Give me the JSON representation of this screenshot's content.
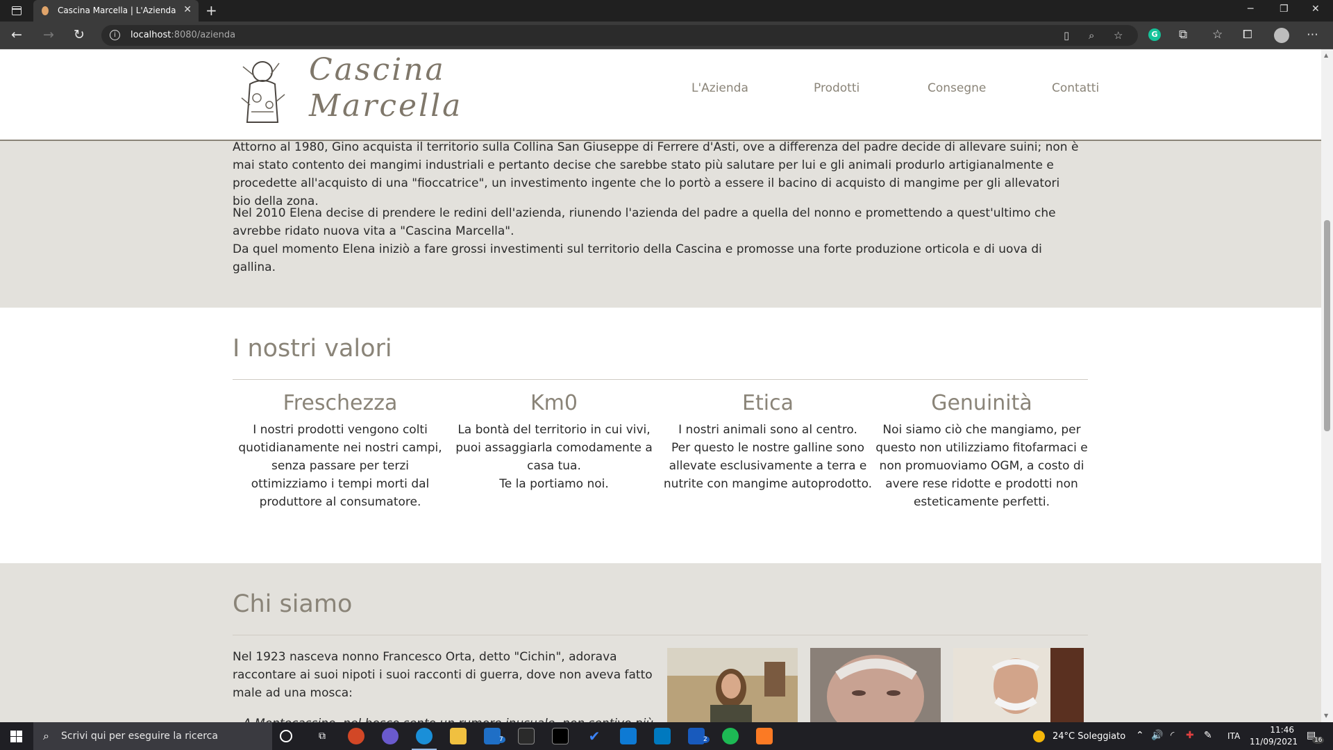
{
  "browser": {
    "tab_title": "Cascina Marcella | L'Azienda",
    "url_host": "localhost",
    "url_rest": ":8080/azienda",
    "colors": {
      "chrome_bg": "#202020",
      "toolbar_bg": "#3b3b3b"
    }
  },
  "site": {
    "logo_line1": "Cascina",
    "logo_line2": "Marcella",
    "nav": [
      "L'Azienda",
      "Prodotti",
      "Consegne",
      "Contatti"
    ],
    "colors": {
      "accent": "#8a8478",
      "band_bg": "#e3e1dc",
      "text": "#2a2a2a"
    }
  },
  "intro": {
    "p1": "Attorno al 1980, Gino acquista il territorio sulla Collina San Giuseppe di Ferrere d'Asti, ove a differenza del padre decide di allevare suini; non è mai stato contento dei mangimi industriali e pertanto decise che sarebbe stato più salutare per lui e gli animali produrlo artigianalmente e procedette all'acquisto di una \"fioccatrice\", un investimento ingente che lo portò a essere il bacino di acquisto di mangime per gli allevatori bio della zona.",
    "p2_line1": "Nel 2010 Elena decise di prendere le redini dell'azienda, riunendo l'azienda del padre a quella del nonno e promettendo a quest'ultimo che avrebbe ridato nuova vita a \"Cascina Marcella\".",
    "p2_line2": "Da quel momento Elena iniziò a fare grossi investimenti sul territorio della Cascina e promosse una forte produzione orticola e di uova di gallina."
  },
  "values": {
    "title": "I nostri valori",
    "items": [
      {
        "heading": "Freschezza",
        "text": "I nostri prodotti vengono colti quotidianamente nei nostri campi, senza passare per terzi ottimizziamo i tempi morti dal produttore al consumatore."
      },
      {
        "heading": "Km0",
        "text": "La bontà del territorio in cui vivi, puoi assaggiarla comodamente a casa tua.\nTe la portiamo noi."
      },
      {
        "heading": "Etica",
        "text": "I nostri animali sono al centro.\nPer questo le nostre galline sono allevate esclusivamente a terra e nutrite con mangime autoprodotto."
      },
      {
        "heading": "Genuinità",
        "text": "Noi siamo ciò che mangiamo, per questo non utilizziamo fitofarmaci e non promuoviamo OGM, a costo di avere rese ridotte e prodotti non esteticamente perfetti."
      }
    ]
  },
  "who": {
    "title": "Chi siamo",
    "text": "Nel 1923 nasceva nonno Francesco Orta, detto \"Cichin\", adorava raccontare ai suoi nipoti i suoi racconti di guerra, dove non aveva fatto male ad una mosca:",
    "list_item": "A Montecassino, nel bosco sento un rumore inusuale, non sentivo più gli"
  },
  "taskbar": {
    "search_placeholder": "Scrivi qui per eseguire la ricerca",
    "weather": "24°C  Soleggiato",
    "lang": "ITA",
    "time": "11:46",
    "date": "11/09/2021",
    "notifications": "16",
    "mail_badge": "7",
    "word_badge": "2"
  }
}
